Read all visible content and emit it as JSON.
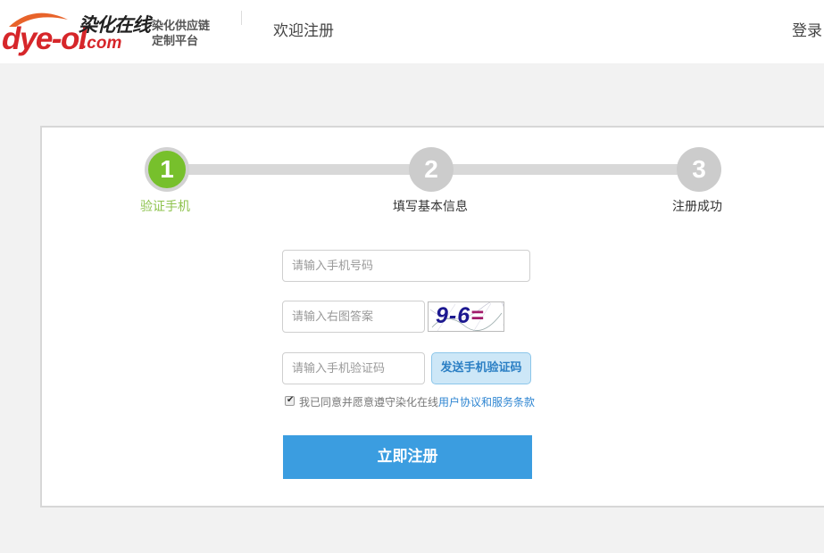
{
  "brand": {
    "logo_latin": "dye-ol",
    "logo_cn": "染化在线",
    "logo_domain": ".com",
    "slogan_line1": "染化供应链",
    "slogan_line2": "定制平台"
  },
  "header": {
    "title": "欢迎注册",
    "login_label": "登录"
  },
  "steps": [
    {
      "number": "1",
      "label": "验证手机",
      "state": "active"
    },
    {
      "number": "2",
      "label": "填写基本信息",
      "state": "pending"
    },
    {
      "number": "3",
      "label": "注册成功",
      "state": "pending"
    }
  ],
  "form": {
    "phone_placeholder": "请输入手机号码",
    "phone_value": "",
    "captcha_placeholder": "请输入右图答案",
    "captcha_value": "",
    "captcha_image_text": "9-6",
    "captcha_image_eq": "=",
    "sms_placeholder": "请输入手机验证码",
    "sms_value": "",
    "send_code_label": "发送手机验证码",
    "agree_checked": true,
    "agree_text": "我已同意并愿意遵守染化在线",
    "agree_link": "用户协议和服务条款",
    "submit_label": "立即注册"
  },
  "colors": {
    "active_step": "#77c02c",
    "active_label": "#8fc34f",
    "pending_step": "#cccccc",
    "primary_button": "#3b9de0",
    "brand_red": "#d6262a",
    "link": "#2f86d2"
  }
}
